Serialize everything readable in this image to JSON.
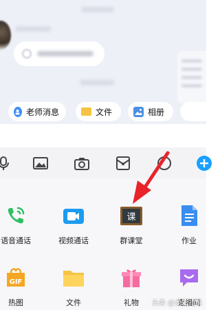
{
  "quick_actions": {
    "teacher_message": "老师消息",
    "file": "文件",
    "album": "相册"
  },
  "toolbar_icons": [
    "microphone-icon",
    "image-icon",
    "camera-icon",
    "red-packet-icon",
    "emoji-icon",
    "plus-icon"
  ],
  "apps": {
    "voice_call": "语音通话",
    "video_call": "视频通话",
    "group_class": "群课堂",
    "homework": "作业",
    "hot_gif": "热图",
    "file": "文件",
    "gift": "礼物",
    "live": "直播间"
  },
  "group_class_icon_text": "课",
  "gif_badge": "GIF",
  "watermark": "头条 @龙彩儿科",
  "colors": {
    "accent_blue": "#3d8ef7",
    "arrow_red": "#e8242a",
    "plus_blue": "#1aa0ff"
  }
}
